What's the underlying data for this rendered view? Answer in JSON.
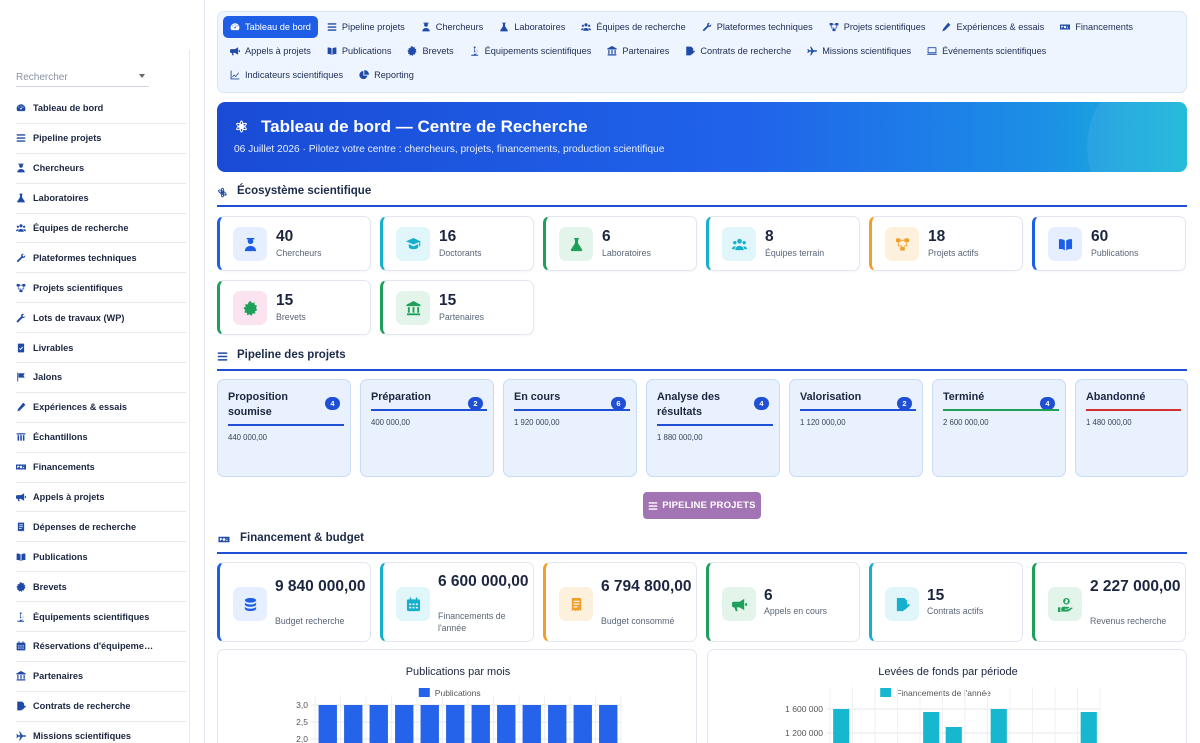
{
  "colors": {
    "accent": "#1e5ee6",
    "teal": "#17b0cc",
    "green": "#1ea05a",
    "orange": "#f0a02a",
    "purple": "#a374b3",
    "red": "#d32f2f"
  },
  "sidebar": {
    "search_placeholder": "Rechercher",
    "items": [
      {
        "label": "Tableau de bord",
        "icon": "dashboard-icon"
      },
      {
        "label": "Pipeline projets",
        "icon": "list-icon"
      },
      {
        "label": "Chercheurs",
        "icon": "researcher-icon"
      },
      {
        "label": "Laboratoires",
        "icon": "flask-icon"
      },
      {
        "label": "Équipes de recherche",
        "icon": "team-icon"
      },
      {
        "label": "Plateformes techniques",
        "icon": "tools-icon"
      },
      {
        "label": "Projets scientifiques",
        "icon": "project-icon"
      },
      {
        "label": "Lots de travaux (WP)",
        "icon": "wrench-icon"
      },
      {
        "label": "Livrables",
        "icon": "check-icon"
      },
      {
        "label": "Jalons",
        "icon": "flag-icon"
      },
      {
        "label": "Expériences & essais",
        "icon": "pen-icon"
      },
      {
        "label": "Échantillons",
        "icon": "vial-icon"
      },
      {
        "label": "Financements",
        "icon": "money-icon"
      },
      {
        "label": "Appels à projets",
        "icon": "megaphone-icon"
      },
      {
        "label": "Dépenses de recherche",
        "icon": "receipt-icon"
      },
      {
        "label": "Publications",
        "icon": "book-icon"
      },
      {
        "label": "Brevets",
        "icon": "patent-icon"
      },
      {
        "label": "Équipements scientifiques",
        "icon": "microscope-icon"
      },
      {
        "label": "Réservations d'équipeme…",
        "icon": "calendar-icon"
      },
      {
        "label": "Partenaires",
        "icon": "institution-icon"
      },
      {
        "label": "Contrats de recherche",
        "icon": "contract-icon"
      },
      {
        "label": "Missions scientifiques",
        "icon": "plane-icon"
      }
    ]
  },
  "topnav": {
    "row1": [
      {
        "label": "Tableau de bord",
        "icon": "dashboard-icon",
        "active": true
      },
      {
        "label": "Pipeline projets",
        "icon": "list-icon"
      },
      {
        "label": "Chercheurs",
        "icon": "researcher-icon"
      },
      {
        "label": "Laboratoires",
        "icon": "flask-icon"
      },
      {
        "label": "Équipes de recherche",
        "icon": "team-icon"
      },
      {
        "label": "Plateformes techniques",
        "icon": "tools-icon"
      },
      {
        "label": "Projets scientifiques",
        "icon": "project-icon"
      },
      {
        "label": "Expériences & essais",
        "icon": "pen-icon"
      },
      {
        "label": "Financements",
        "icon": "money-icon"
      }
    ],
    "row2": [
      {
        "label": "Appels à projets",
        "icon": "megaphone-icon"
      },
      {
        "label": "Publications",
        "icon": "book-icon"
      },
      {
        "label": "Brevets",
        "icon": "patent-icon"
      },
      {
        "label": "Équipements scientifiques",
        "icon": "microscope-icon"
      },
      {
        "label": "Partenaires",
        "icon": "institution-icon"
      },
      {
        "label": "Contrats de recherche",
        "icon": "contract-icon"
      },
      {
        "label": "Missions scientifiques",
        "icon": "plane-icon"
      },
      {
        "label": "Événements scientifiques",
        "icon": "monitor-icon"
      }
    ],
    "row3": [
      {
        "label": "Indicateurs scientifiques",
        "icon": "chart-icon"
      },
      {
        "label": "Reporting",
        "icon": "pie-icon"
      }
    ]
  },
  "hero": {
    "title": "Tableau de bord — Centre de Recherche",
    "subtitle": "06 Juillet 2026 · Pilotez votre centre : chercheurs, projets, financements, production scientifique",
    "icon": "atom-icon"
  },
  "sections": {
    "ecosystem": "Écosystème scientifique",
    "pipeline": "Pipeline des projets",
    "funding": "Financement & budget"
  },
  "ecosystem_cards": [
    {
      "value": "40",
      "label": "Chercheurs",
      "icon": "researcher-icon",
      "color": "#1e5ee6",
      "bg": "#e6efff"
    },
    {
      "value": "16",
      "label": "Doctorants",
      "icon": "graduate-icon",
      "color": "#17b0cc",
      "bg": "#e0f6fa"
    },
    {
      "value": "6",
      "label": "Laboratoires",
      "icon": "flask-icon",
      "color": "#1ea05a",
      "bg": "#e3f5ea"
    },
    {
      "value": "8",
      "label": "Équipes terrain",
      "icon": "team-icon",
      "color": "#17b0cc",
      "bg": "#e0f6fa"
    },
    {
      "value": "18",
      "label": "Projets actifs",
      "icon": "project-icon",
      "color": "#f0a02a",
      "bg": "#fdf1dd"
    },
    {
      "value": "60",
      "label": "Publications",
      "icon": "book-icon",
      "color": "#1e5ee6",
      "bg": "#e6efff"
    },
    {
      "value": "15",
      "label": "Brevets",
      "icon": "patent-icon",
      "color": "#1ea05a",
      "bg": "#fbe3ef",
      "icon_color": "#1ea05a"
    },
    {
      "value": "15",
      "label": "Partenaires",
      "icon": "institution-icon",
      "color": "#1ea05a",
      "bg": "#e3f5ea"
    }
  ],
  "pipeline": {
    "stages": [
      {
        "name": "Proposition soumise",
        "count": "4",
        "amount": "440 000,00",
        "color": "#1f4fd4"
      },
      {
        "name": "Préparation",
        "count": "2",
        "amount": "400 000,00",
        "color": "#1f4fd4"
      },
      {
        "name": "En cours",
        "count": "6",
        "amount": "1 920 000,00",
        "color": "#1f4fd4"
      },
      {
        "name": "Analyse des résultats",
        "count": "4",
        "amount": "1 880 000,00",
        "color": "#1f4fd4"
      },
      {
        "name": "Valorisation",
        "count": "2",
        "amount": "1 120 000,00",
        "color": "#1f4fd4"
      },
      {
        "name": "Terminé",
        "count": "4",
        "amount": "2 600 000,00",
        "color": "#1ea05a"
      },
      {
        "name": "Abandonné",
        "count": "",
        "amount": "1 480 000,00",
        "color": "#d32f2f"
      }
    ],
    "button_label": "PIPELINE PROJETS"
  },
  "funding_cards": [
    {
      "value": "9 840 000,00",
      "label": "Budget recherche",
      "icon": "coins-icon",
      "color": "#1e5ee6",
      "bg": "#e6efff"
    },
    {
      "value": "6 600 000,00",
      "label": "Financements de l'année",
      "icon": "calendar-icon",
      "color": "#17b0cc",
      "bg": "#e0f6fa"
    },
    {
      "value": "6 794 800,00",
      "label": "Budget consommé",
      "icon": "receipt-icon",
      "color": "#f0a02a",
      "bg": "#fdf1dd"
    },
    {
      "value": "6",
      "label": "Appels en cours",
      "icon": "megaphone-icon",
      "color": "#1ea05a",
      "bg": "#e3f5ea"
    },
    {
      "value": "15",
      "label": "Contrats actifs",
      "icon": "contract-icon",
      "color": "#17b0cc",
      "bg": "#e0f6fa"
    },
    {
      "value": "2 227 000,00",
      "label": "Revenus recherche",
      "icon": "hand-money-icon",
      "color": "#1ea05a",
      "bg": "#e3f5ea"
    }
  ],
  "chart_data": [
    {
      "type": "bar",
      "title": "Publications par mois",
      "series": [
        {
          "name": "Publications",
          "color": "#2563eb",
          "values": [
            3,
            3,
            3,
            3,
            3,
            3,
            3,
            3,
            3,
            3,
            3,
            3
          ]
        }
      ],
      "y_ticks": [
        "3,0",
        "2,5",
        "2,0"
      ],
      "ylim": [
        0,
        3.0
      ],
      "grid": true,
      "legend": "top"
    },
    {
      "type": "bar",
      "title": "Levées de fonds par période",
      "series": [
        {
          "name": "Financements de l'année",
          "color": "#17b7d0",
          "values": [
            1600000,
            0,
            0,
            0,
            1550000,
            1300000,
            0,
            1600000,
            0,
            0,
            0,
            1550000
          ]
        }
      ],
      "y_ticks": [
        "1 600 000",
        "1 200 000"
      ],
      "ylim": [
        0,
        1800000
      ],
      "grid": true,
      "legend": "top"
    }
  ]
}
